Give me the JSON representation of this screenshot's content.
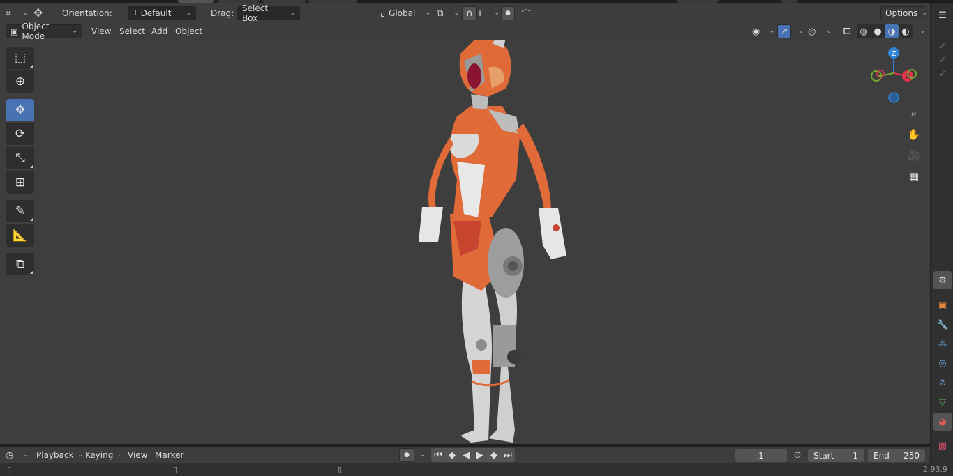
{
  "header": {
    "orientation_label": "Orientation:",
    "orientation_value": "Default",
    "drag_label": "Drag:",
    "drag_value": "Select Box",
    "transform_space": "Global",
    "options_label": "Options"
  },
  "viewport_header": {
    "mode": "Object Mode",
    "menus": [
      "View",
      "Select",
      "Add",
      "Object"
    ]
  },
  "toolbar": {
    "tools": [
      {
        "name": "select-box",
        "icon": "select-box-icon"
      },
      {
        "name": "cursor",
        "icon": "cursor-icon"
      },
      {
        "name": "move",
        "icon": "move-icon",
        "active": true
      },
      {
        "name": "rotate",
        "icon": "rotate-icon"
      },
      {
        "name": "scale",
        "icon": "scale-icon"
      },
      {
        "name": "transform",
        "icon": "transform-icon"
      },
      {
        "name": "annotate",
        "icon": "annotate-icon"
      },
      {
        "name": "measure",
        "icon": "measure-icon"
      },
      {
        "name": "add-cube",
        "icon": "add-cube-icon"
      }
    ]
  },
  "gizmo": {
    "z_label": "Z",
    "x_label": "X",
    "colors": {
      "x": "#e0334a",
      "y": "#76a62f",
      "z": "#2f83d8"
    }
  },
  "timeline": {
    "menus": [
      "Playback",
      "Keying",
      "View",
      "Marker"
    ],
    "current_frame": "1",
    "start_label": "Start",
    "start_value": "1",
    "end_label": "End",
    "end_value": "250"
  },
  "status": {
    "version": "2.93.9"
  },
  "colors": {
    "accent": "#4772b3",
    "viewport_bg": "#3e3e3e",
    "header_bg": "#3d3d3d",
    "model_orange": "#e06a38",
    "model_white": "#d4d4d4",
    "model_red": "#c7442f"
  }
}
